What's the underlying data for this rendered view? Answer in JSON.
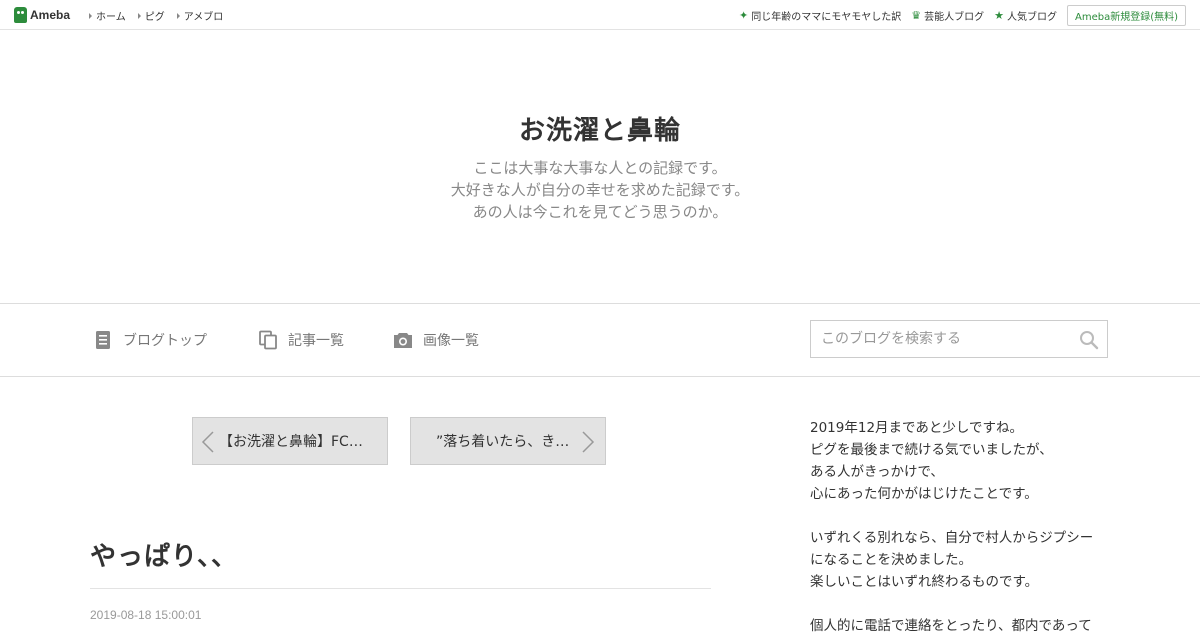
{
  "topbar": {
    "logo_text": "Ameba",
    "nav": [
      "ホーム",
      "ピグ",
      "アメブロ"
    ],
    "right_links": [
      {
        "icon": "sparkle-icon",
        "label": "同じ年齢のママにモヤモヤした訳"
      },
      {
        "icon": "crown-icon",
        "label": "芸能人ブログ"
      },
      {
        "icon": "star-icon",
        "label": "人気ブログ"
      }
    ],
    "register_label": "Ameba新規登録(無料)",
    "accent_color": "#2d8c3c"
  },
  "header": {
    "title": "お洗濯と鼻輪",
    "description": [
      "ここは大事な大事な人との記録です。",
      "大好きな人が自分の幸せを求めた記録です。",
      "あの人は今これを見てどう思うのか。"
    ]
  },
  "global_nav": {
    "items": [
      {
        "icon": "document-icon",
        "label": "ブログトップ"
      },
      {
        "icon": "copy-icon",
        "label": "記事一覧"
      },
      {
        "icon": "camera-icon",
        "label": "画像一覧"
      }
    ],
    "search": {
      "placeholder": "このブログを検索する",
      "value": ""
    }
  },
  "entry_pager": {
    "prev_label": "【お洗濯と鼻輪】FC…",
    "next_label": "”落ち着いたら、きち…"
  },
  "entry": {
    "title": "やっぱり、、",
    "date": "2019-08-18 15:00:01"
  },
  "sidebar": {
    "profile_lines": [
      "2019年12月まであと少しですね。",
      "ピグを最後まで続ける気でいましたが、",
      "ある人がきっかけで、",
      "心にあった何かがはじけたことです。",
      "",
      "いずれくる別れなら、自分で村人からジプシー",
      "になることを決めました。",
      "楽しいことはいずれ終わるものです。",
      "",
      "個人的に電話で連絡をとったり、都内であって"
    ]
  }
}
